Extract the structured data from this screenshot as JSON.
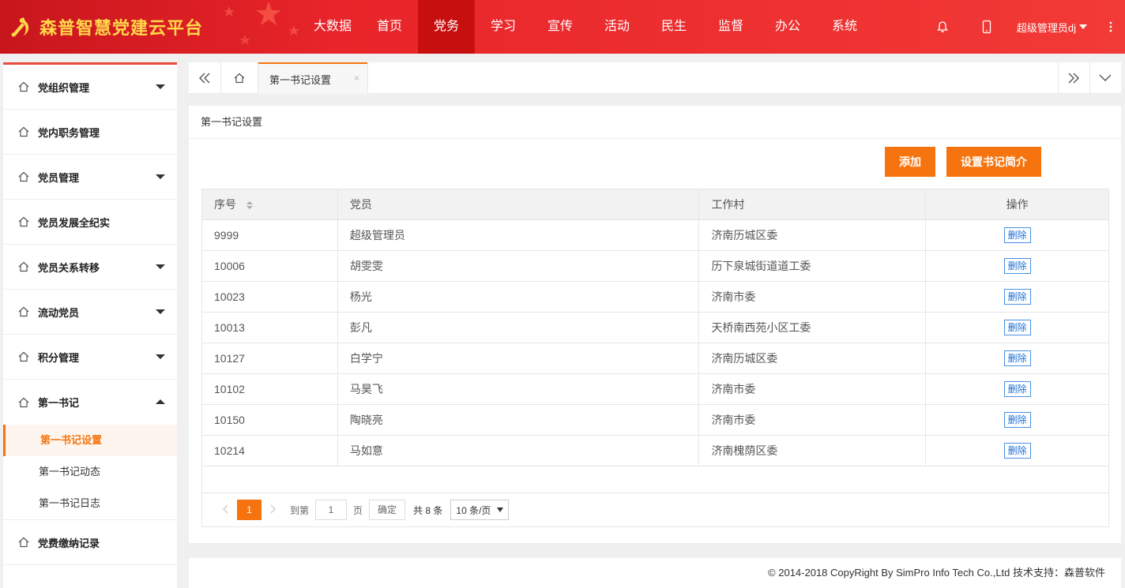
{
  "app": {
    "title": "森普智慧党建云平台"
  },
  "nav": [
    "大数据",
    "首页",
    "党务",
    "学习",
    "宣传",
    "活动",
    "民生",
    "监督",
    "办公",
    "系统"
  ],
  "nav_active": "党务",
  "user": {
    "name": "超级管理员dj"
  },
  "sidebar": {
    "items": [
      {
        "label": "党组织管理",
        "arrow": "down"
      },
      {
        "label": "党内职务管理",
        "arrow": "none"
      },
      {
        "label": "党员管理",
        "arrow": "down"
      },
      {
        "label": "党员发展全纪实",
        "arrow": "none"
      },
      {
        "label": "党员关系转移",
        "arrow": "down"
      },
      {
        "label": "流动党员",
        "arrow": "down"
      },
      {
        "label": "积分管理",
        "arrow": "down"
      },
      {
        "label": "第一书记",
        "arrow": "up"
      }
    ],
    "subitems": [
      "第一书记设置",
      "第一书记动态",
      "第一书记日志"
    ],
    "last_item": "党费缴纳记录"
  },
  "tab": {
    "label": "第一书记设置",
    "close": "×"
  },
  "panel": {
    "title": "第一书记设置",
    "add_button": "添加",
    "intro_button": "设置书记简介"
  },
  "table": {
    "headers": [
      "序号",
      "党员",
      "工作村",
      "操作"
    ],
    "rows": [
      {
        "id": "9999",
        "member": "超级管理员",
        "village": "济南历城区委",
        "action": "删除"
      },
      {
        "id": "10006",
        "member": "胡雯雯",
        "village": "历下泉城街道道工委",
        "action": "删除"
      },
      {
        "id": "10023",
        "member": "杨光",
        "village": "济南市委",
        "action": "删除"
      },
      {
        "id": "10013",
        "member": "彭凡",
        "village": "天桥南西苑小区工委",
        "action": "删除"
      },
      {
        "id": "10127",
        "member": "白学宁",
        "village": "济南历城区委",
        "action": "删除"
      },
      {
        "id": "10102",
        "member": "马昊飞",
        "village": "济南市委",
        "action": "删除"
      },
      {
        "id": "10150",
        "member": "陶晓亮",
        "village": "济南市委",
        "action": "删除"
      },
      {
        "id": "10214",
        "member": "马如意",
        "village": "济南槐荫区委",
        "action": "删除"
      }
    ]
  },
  "pager": {
    "current": "1",
    "goto_label": "到第",
    "goto_value": "1",
    "page_label": "页",
    "confirm": "确定",
    "total": "共 8 条",
    "page_size": "10 条/页"
  },
  "footer": {
    "text": "© 2014-2018 CopyRight By SimPro Info Tech Co.,Ltd 技术支持：森普软件"
  },
  "colors": {
    "header_red": "#e8252a",
    "accent_orange": "#f6740f",
    "brand_gold": "#ffd74a"
  }
}
